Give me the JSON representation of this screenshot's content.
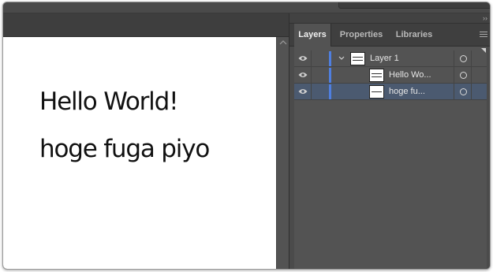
{
  "panel": {
    "tabs": [
      {
        "label": "Layers",
        "active": true
      },
      {
        "label": "Properties",
        "active": false
      },
      {
        "label": "Libraries",
        "active": false
      }
    ]
  },
  "canvas": {
    "lines": [
      "Hello World!",
      "hoge fuga piyo"
    ]
  },
  "layers": [
    {
      "name": "Layer 1",
      "type": "layer",
      "expanded": true,
      "visible": true,
      "selected": false,
      "color": "#4f7fe0"
    },
    {
      "name": "Hello Wo...",
      "type": "text",
      "visible": true,
      "selected": false,
      "color": "#4f7fe0"
    },
    {
      "name": "hoge fu...",
      "type": "text",
      "visible": false,
      "selected": true,
      "color": "#4f7fe0"
    }
  ],
  "colors": {
    "selection": "#4b5a70",
    "layer_color": "#4f7fe0"
  },
  "icons": {
    "collapse": "double-chevron-right-icon",
    "panel_menu": "hamburger-menu-icon",
    "visibility": "eye-icon",
    "expand": "chevron-down-icon",
    "target": "target-circle-icon",
    "scroll_up": "chevron-up-icon"
  }
}
